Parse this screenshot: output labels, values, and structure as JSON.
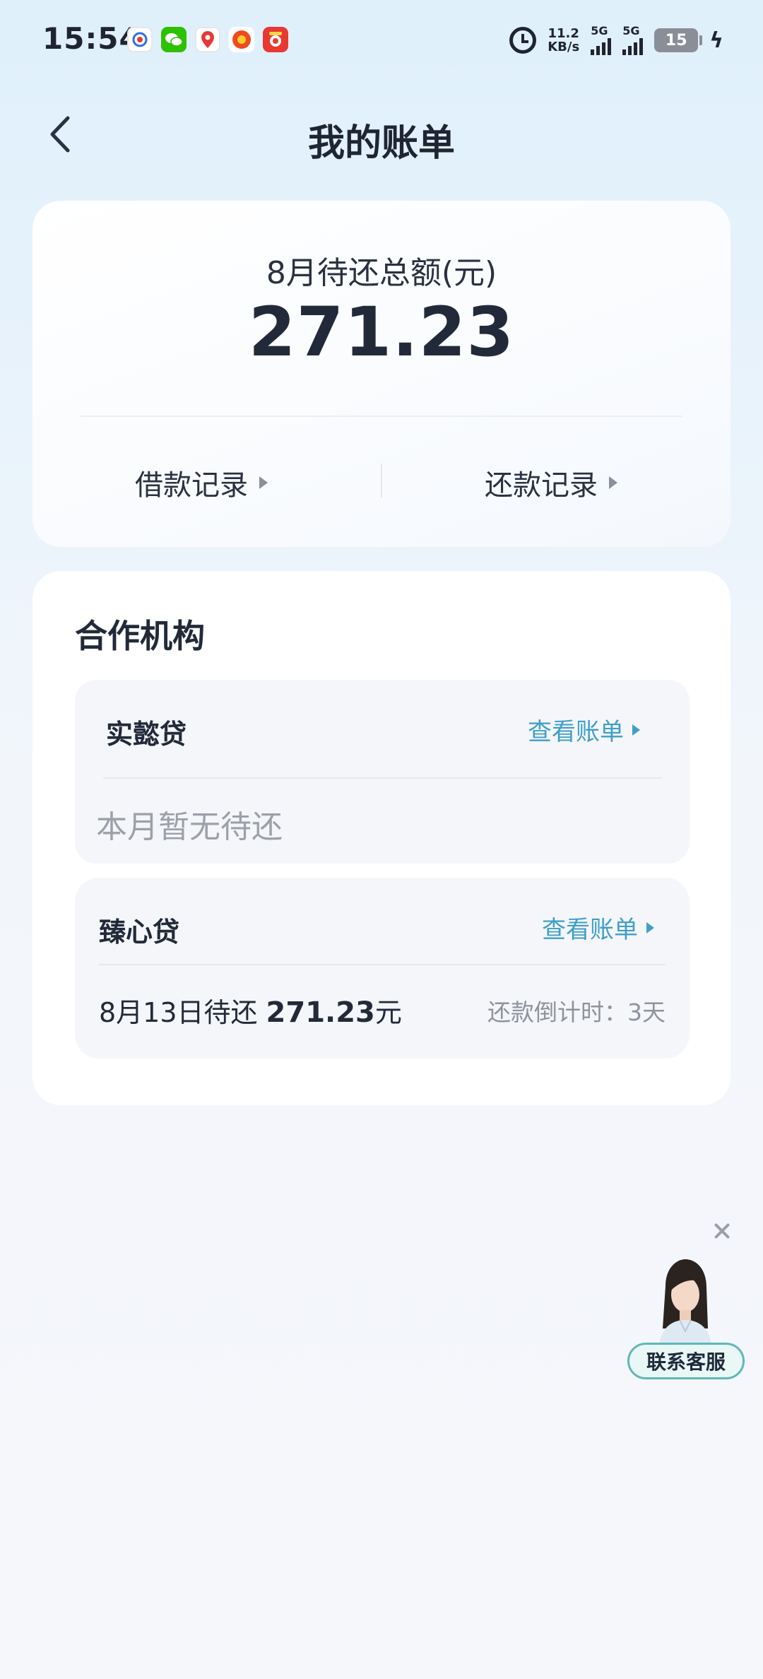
{
  "status_bar": {
    "time": "15:54",
    "net_speed_value": "11.2",
    "net_speed_unit": "KB/s",
    "sim1": "5G",
    "sim2": "5G",
    "battery": "15",
    "notification_icons": [
      "baidu-icon",
      "wechat-icon",
      "maps-icon",
      "discount-app-icon",
      "red-app-icon"
    ]
  },
  "header": {
    "title": "我的账单",
    "back_icon": "chevron-left-icon"
  },
  "summary": {
    "label": "8月待还总额(元)",
    "amount": "271.23",
    "borrow_record": "借款记录",
    "repay_record": "还款记录"
  },
  "partners": {
    "title": "合作机构",
    "items": [
      {
        "name": "实懿贷",
        "link": "查看账单",
        "empty_text": "本月暂无待还"
      },
      {
        "name": "臻心贷",
        "link": "查看账单",
        "due_prefix": "8月13日待还",
        "due_amount": "271.23",
        "due_unit": "元",
        "countdown": "还款倒计时：3天"
      }
    ]
  },
  "customer_service": {
    "label": "联系客服"
  },
  "colors": {
    "accent_link": "#3e9fc9",
    "cs_border": "#5fb7b8"
  }
}
